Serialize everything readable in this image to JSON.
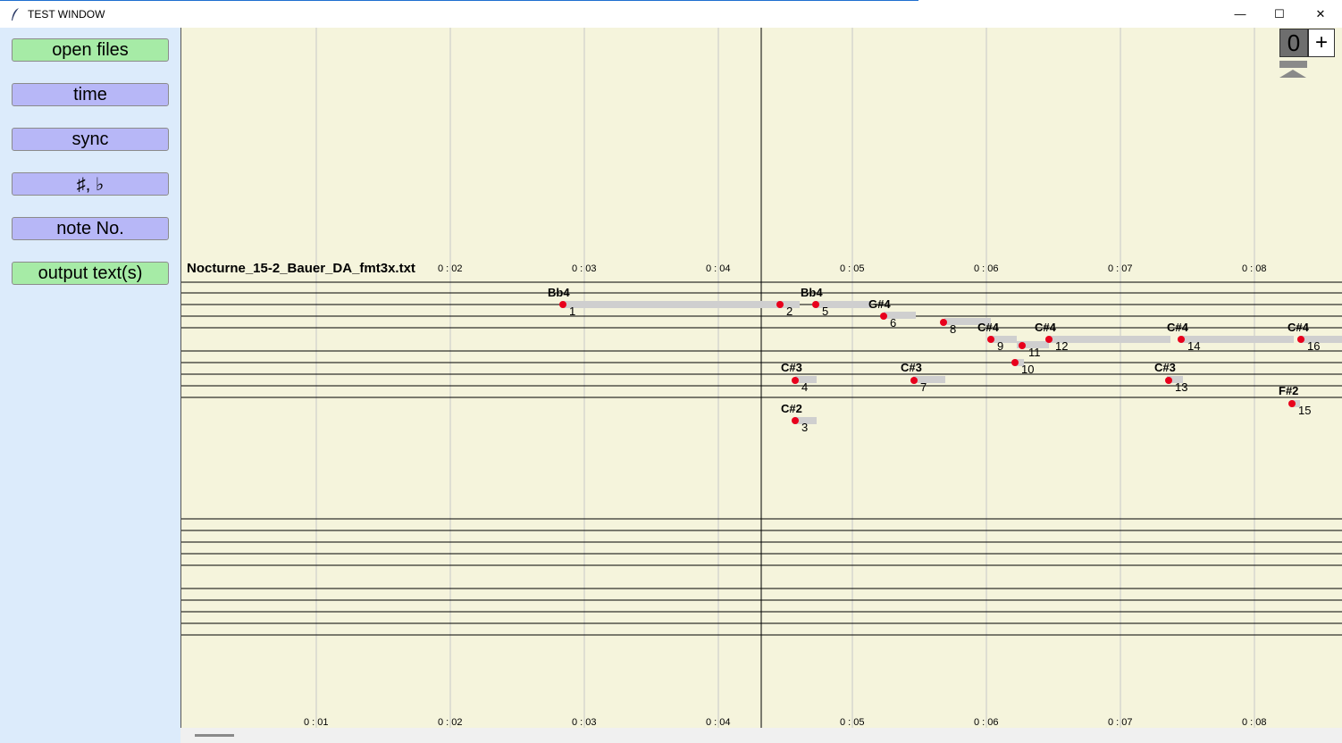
{
  "window": {
    "title": "TEST WINDOW",
    "minimize_glyph": "—",
    "maximize_glyph": "☐",
    "close_glyph": "✕"
  },
  "sidebar": {
    "buttons": [
      {
        "label": "open files",
        "color": "#a6eba6"
      },
      {
        "label": "time",
        "color": "#b7b7f7"
      },
      {
        "label": "sync",
        "color": "#b7b7f7"
      },
      {
        "label": "♯, ♭",
        "color": "#b7b7f7"
      },
      {
        "label": "note No.",
        "color": "#b7b7f7"
      },
      {
        "label": "output text(s)",
        "color": "#a6eba6"
      }
    ]
  },
  "canvas": {
    "file_name": "Nocturne_15-2_Bauer_DA_fmt3x.txt",
    "time_labels": [
      "0 : 01",
      "0 : 02",
      "0 : 03",
      "0 : 04",
      "0 : 05",
      "0 : 06",
      "0 : 07",
      "0 : 08"
    ],
    "zoom_value": "0",
    "zoom_plus": "+",
    "notes": [
      {
        "num": "1",
        "pitch": "Bb4"
      },
      {
        "num": "2",
        "pitch": ""
      },
      {
        "num": "3",
        "pitch": "C#2"
      },
      {
        "num": "4",
        "pitch": "C#3"
      },
      {
        "num": "5",
        "pitch": "Bb4"
      },
      {
        "num": "6",
        "pitch": "G#4"
      },
      {
        "num": "7",
        "pitch": "C#3"
      },
      {
        "num": "8",
        "pitch": ""
      },
      {
        "num": "9",
        "pitch": "C#4"
      },
      {
        "num": "10",
        "pitch": ""
      },
      {
        "num": "11",
        "pitch": ""
      },
      {
        "num": "12",
        "pitch": "C#4"
      },
      {
        "num": "13",
        "pitch": "C#3"
      },
      {
        "num": "14",
        "pitch": "C#4"
      },
      {
        "num": "15",
        "pitch": "F#2"
      },
      {
        "num": "16",
        "pitch": "C#4"
      }
    ]
  },
  "colors": {
    "canvas_bg": "#f5f4dc",
    "note_dot": "#e8001c",
    "note_bar": "#cfcfcf",
    "sidebar_bg": "#dcebfb"
  }
}
